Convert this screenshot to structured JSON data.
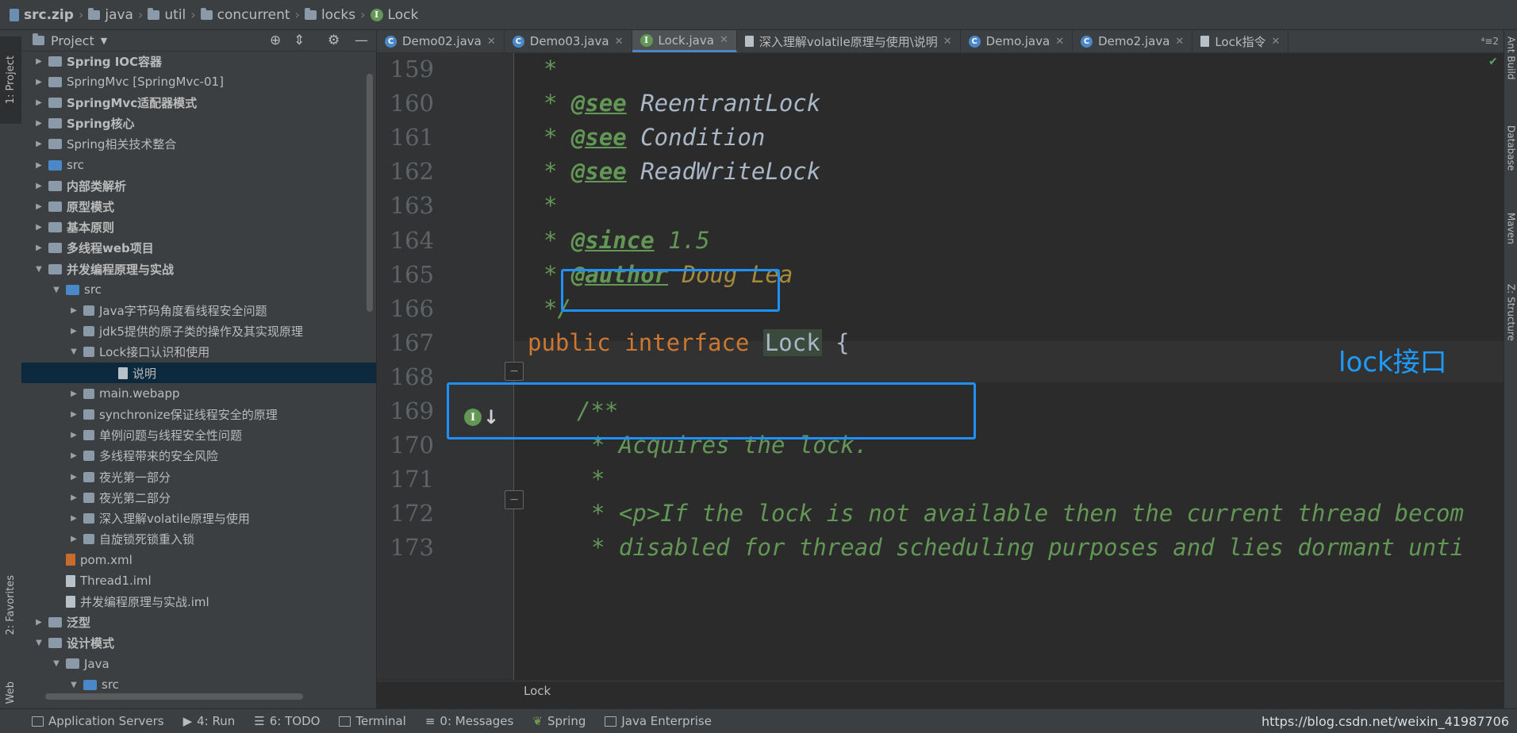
{
  "breadcrumb": [
    "src.zip",
    "java",
    "util",
    "concurrent",
    "locks",
    "Lock"
  ],
  "left_tool_tabs": {
    "project": "1: Project",
    "favorites": "2: Favorites",
    "web": "Web"
  },
  "project_panel": {
    "title": "Project"
  },
  "tree": [
    {
      "label": "Spring IOC容器",
      "indent": 1,
      "expanded": false,
      "icon": "folder",
      "bold": true
    },
    {
      "label": "SpringMvc [SpringMvc-01]",
      "indent": 1,
      "expanded": false,
      "icon": "folder",
      "bold": false
    },
    {
      "label": "SpringMvc适配器模式",
      "indent": 1,
      "expanded": false,
      "icon": "folder",
      "bold": true
    },
    {
      "label": "Spring核心",
      "indent": 1,
      "expanded": false,
      "icon": "folder",
      "bold": true
    },
    {
      "label": "Spring相关技术整合",
      "indent": 1,
      "expanded": false,
      "icon": "folder",
      "bold": false
    },
    {
      "label": "src",
      "indent": 1,
      "expanded": false,
      "icon": "folder-blue",
      "bold": false
    },
    {
      "label": "内部类解析",
      "indent": 1,
      "expanded": false,
      "icon": "folder",
      "bold": true
    },
    {
      "label": "原型模式",
      "indent": 1,
      "expanded": false,
      "icon": "folder",
      "bold": true
    },
    {
      "label": "基本原则",
      "indent": 1,
      "expanded": false,
      "icon": "folder",
      "bold": true
    },
    {
      "label": "多线程web项目",
      "indent": 1,
      "expanded": false,
      "icon": "folder",
      "bold": true
    },
    {
      "label": "并发编程原理与实战",
      "indent": 1,
      "expanded": true,
      "icon": "folder",
      "bold": true
    },
    {
      "label": "src",
      "indent": 2,
      "expanded": true,
      "icon": "folder-blue",
      "bold": false
    },
    {
      "label": "Java字节码角度看线程安全问题",
      "indent": 3,
      "expanded": false,
      "icon": "package",
      "bold": false
    },
    {
      "label": "jdk5提供的原子类的操作及其实现原理",
      "indent": 3,
      "expanded": false,
      "icon": "package",
      "bold": false
    },
    {
      "label": "Lock接口认识和使用",
      "indent": 3,
      "expanded": true,
      "icon": "package",
      "bold": false
    },
    {
      "label": "说明",
      "indent": 5,
      "expanded": null,
      "icon": "file",
      "bold": false,
      "selected": true
    },
    {
      "label": "main.webapp",
      "indent": 3,
      "expanded": false,
      "icon": "package",
      "bold": false
    },
    {
      "label": "synchronize保证线程安全的原理",
      "indent": 3,
      "expanded": false,
      "icon": "package",
      "bold": false
    },
    {
      "label": "单例问题与线程安全性问题",
      "indent": 3,
      "expanded": false,
      "icon": "package",
      "bold": false
    },
    {
      "label": "多线程带来的安全风险",
      "indent": 3,
      "expanded": false,
      "icon": "package",
      "bold": false
    },
    {
      "label": "夜光第一部分",
      "indent": 3,
      "expanded": false,
      "icon": "package",
      "bold": false
    },
    {
      "label": "夜光第二部分",
      "indent": 3,
      "expanded": false,
      "icon": "package",
      "bold": false
    },
    {
      "label": "深入理解volatile原理与使用",
      "indent": 3,
      "expanded": false,
      "icon": "package",
      "bold": false
    },
    {
      "label": "自旋锁死锁重入锁",
      "indent": 3,
      "expanded": false,
      "icon": "package",
      "bold": false
    },
    {
      "label": "pom.xml",
      "indent": 2,
      "expanded": null,
      "icon": "xml",
      "bold": false
    },
    {
      "label": "Thread1.iml",
      "indent": 2,
      "expanded": null,
      "icon": "file",
      "bold": false
    },
    {
      "label": "并发编程原理与实战.iml",
      "indent": 2,
      "expanded": null,
      "icon": "file",
      "bold": false
    },
    {
      "label": "泛型",
      "indent": 1,
      "expanded": false,
      "icon": "folder",
      "bold": true
    },
    {
      "label": "设计模式",
      "indent": 1,
      "expanded": true,
      "icon": "folder",
      "bold": true
    },
    {
      "label": "Java",
      "indent": 2,
      "expanded": true,
      "icon": "folder",
      "bold": false
    },
    {
      "label": "src",
      "indent": 3,
      "expanded": true,
      "icon": "folder-blue",
      "bold": false
    }
  ],
  "tabs": [
    {
      "label": "Demo02.java",
      "icon": "class",
      "active": false
    },
    {
      "label": "Demo03.java",
      "icon": "class",
      "active": false
    },
    {
      "label": "Lock.java",
      "icon": "interface",
      "active": true
    },
    {
      "label": "深入理解volatile原理与使用\\说明",
      "icon": "doc",
      "active": false
    },
    {
      "label": "Demo.java",
      "icon": "class",
      "active": false
    },
    {
      "label": "Demo2.java",
      "icon": "class",
      "active": false
    },
    {
      "label": "Lock指令",
      "icon": "doc",
      "active": false
    }
  ],
  "tab_overflow": "⁴≡2",
  "right_tool_tabs": [
    "Ant Build",
    "Database",
    "Maven",
    "Z: Structure"
  ],
  "code": {
    "lines": [
      159,
      160,
      161,
      162,
      163,
      164,
      165,
      166,
      167,
      168,
      169,
      170,
      171,
      172,
      173
    ],
    "l160": {
      "star": "* ",
      "tag": "@see",
      "ref": " ReentrantLock"
    },
    "l161": {
      "star": "* ",
      "tag": "@see",
      "ref": " Condition"
    },
    "l162": {
      "star": "* ",
      "tag": "@see",
      "ref": " ReadWriteLock"
    },
    "l164": {
      "star": "* ",
      "tag": "@since",
      "ref": " 1.5"
    },
    "l165": {
      "star": "* ",
      "tag": "@author",
      "ref": " Doug Lea"
    },
    "l166": "*/",
    "l167": {
      "kw1": "public",
      "kw2": "interface",
      "name": "Lock",
      "brace": " {"
    },
    "l169": "/**",
    "l170": "* Acquires the lock.",
    "l171": "*",
    "l172": "* <p>If the lock is not available then the current thread becom",
    "l173": "* disabled for thread scheduling purposes and lies dormant unti"
  },
  "annotation": "lock接口",
  "bottom_breadcrumb": "Lock",
  "tool_windows": [
    "Application Servers",
    "4: Run",
    "6: TODO",
    "Terminal",
    "0: Messages",
    "Spring",
    "Java Enterprise"
  ],
  "watermark": "https://blog.csdn.net/weixin_41987706",
  "colors": {
    "highlight_box": "#1e90ff",
    "annotation_text": "#1e9bff",
    "comment": "#629755",
    "keyword": "#cc7832",
    "selection": "#0d293e"
  }
}
